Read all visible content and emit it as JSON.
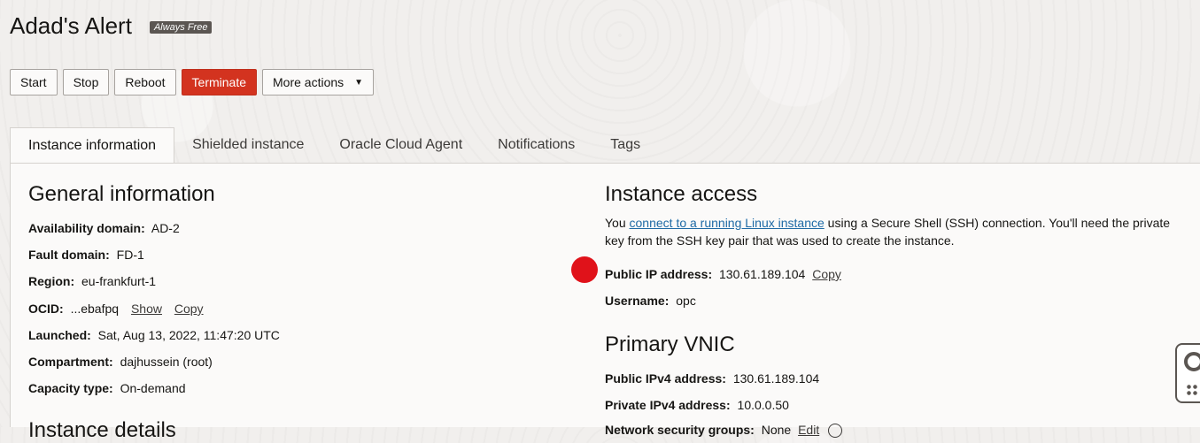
{
  "page": {
    "title": "Adad's Alert",
    "badge": "Always Free"
  },
  "actions": {
    "start": "Start",
    "stop": "Stop",
    "reboot": "Reboot",
    "terminate": "Terminate",
    "more": "More actions"
  },
  "tabs": [
    {
      "label": "Instance information",
      "active": true
    },
    {
      "label": "Shielded instance",
      "active": false
    },
    {
      "label": "Oracle Cloud Agent",
      "active": false
    },
    {
      "label": "Notifications",
      "active": false
    },
    {
      "label": "Tags",
      "active": false
    }
  ],
  "general": {
    "title": "General information",
    "availability_domain": {
      "label": "Availability domain:",
      "value": "AD-2"
    },
    "fault_domain": {
      "label": "Fault domain:",
      "value": "FD-1"
    },
    "region": {
      "label": "Region:",
      "value": "eu-frankfurt-1"
    },
    "ocid": {
      "label": "OCID:",
      "value": "...ebafpq",
      "show": "Show",
      "copy": "Copy"
    },
    "launched": {
      "label": "Launched:",
      "value": "Sat, Aug 13, 2022, 11:47:20 UTC"
    },
    "compartment": {
      "label": "Compartment:",
      "value": "dajhussein (root)"
    },
    "capacity_type": {
      "label": "Capacity type:",
      "value": "On-demand"
    },
    "next_section_partial": "Instance details"
  },
  "access": {
    "title": "Instance access",
    "intro_before": "You ",
    "intro_link": "connect to a running Linux instance",
    "intro_after": " using a Secure Shell (SSH) connection. You'll need the private key from the SSH key pair that was used to create the instance.",
    "public_ip": {
      "label": "Public IP address:",
      "value": "130.61.189.104",
      "copy": "Copy"
    },
    "username": {
      "label": "Username:",
      "value": "opc"
    }
  },
  "vnic": {
    "title": "Primary VNIC",
    "public_ipv4": {
      "label": "Public IPv4 address:",
      "value": "130.61.189.104"
    },
    "private_ipv4": {
      "label": "Private IPv4 address:",
      "value": "10.0.0.50"
    },
    "nsg_partial": {
      "label": "Network security groups:",
      "value": "None",
      "edit": "Edit"
    }
  },
  "colors": {
    "terminate": "#d3331f",
    "link": "#1e6aa5",
    "marker": "#e0121a"
  }
}
